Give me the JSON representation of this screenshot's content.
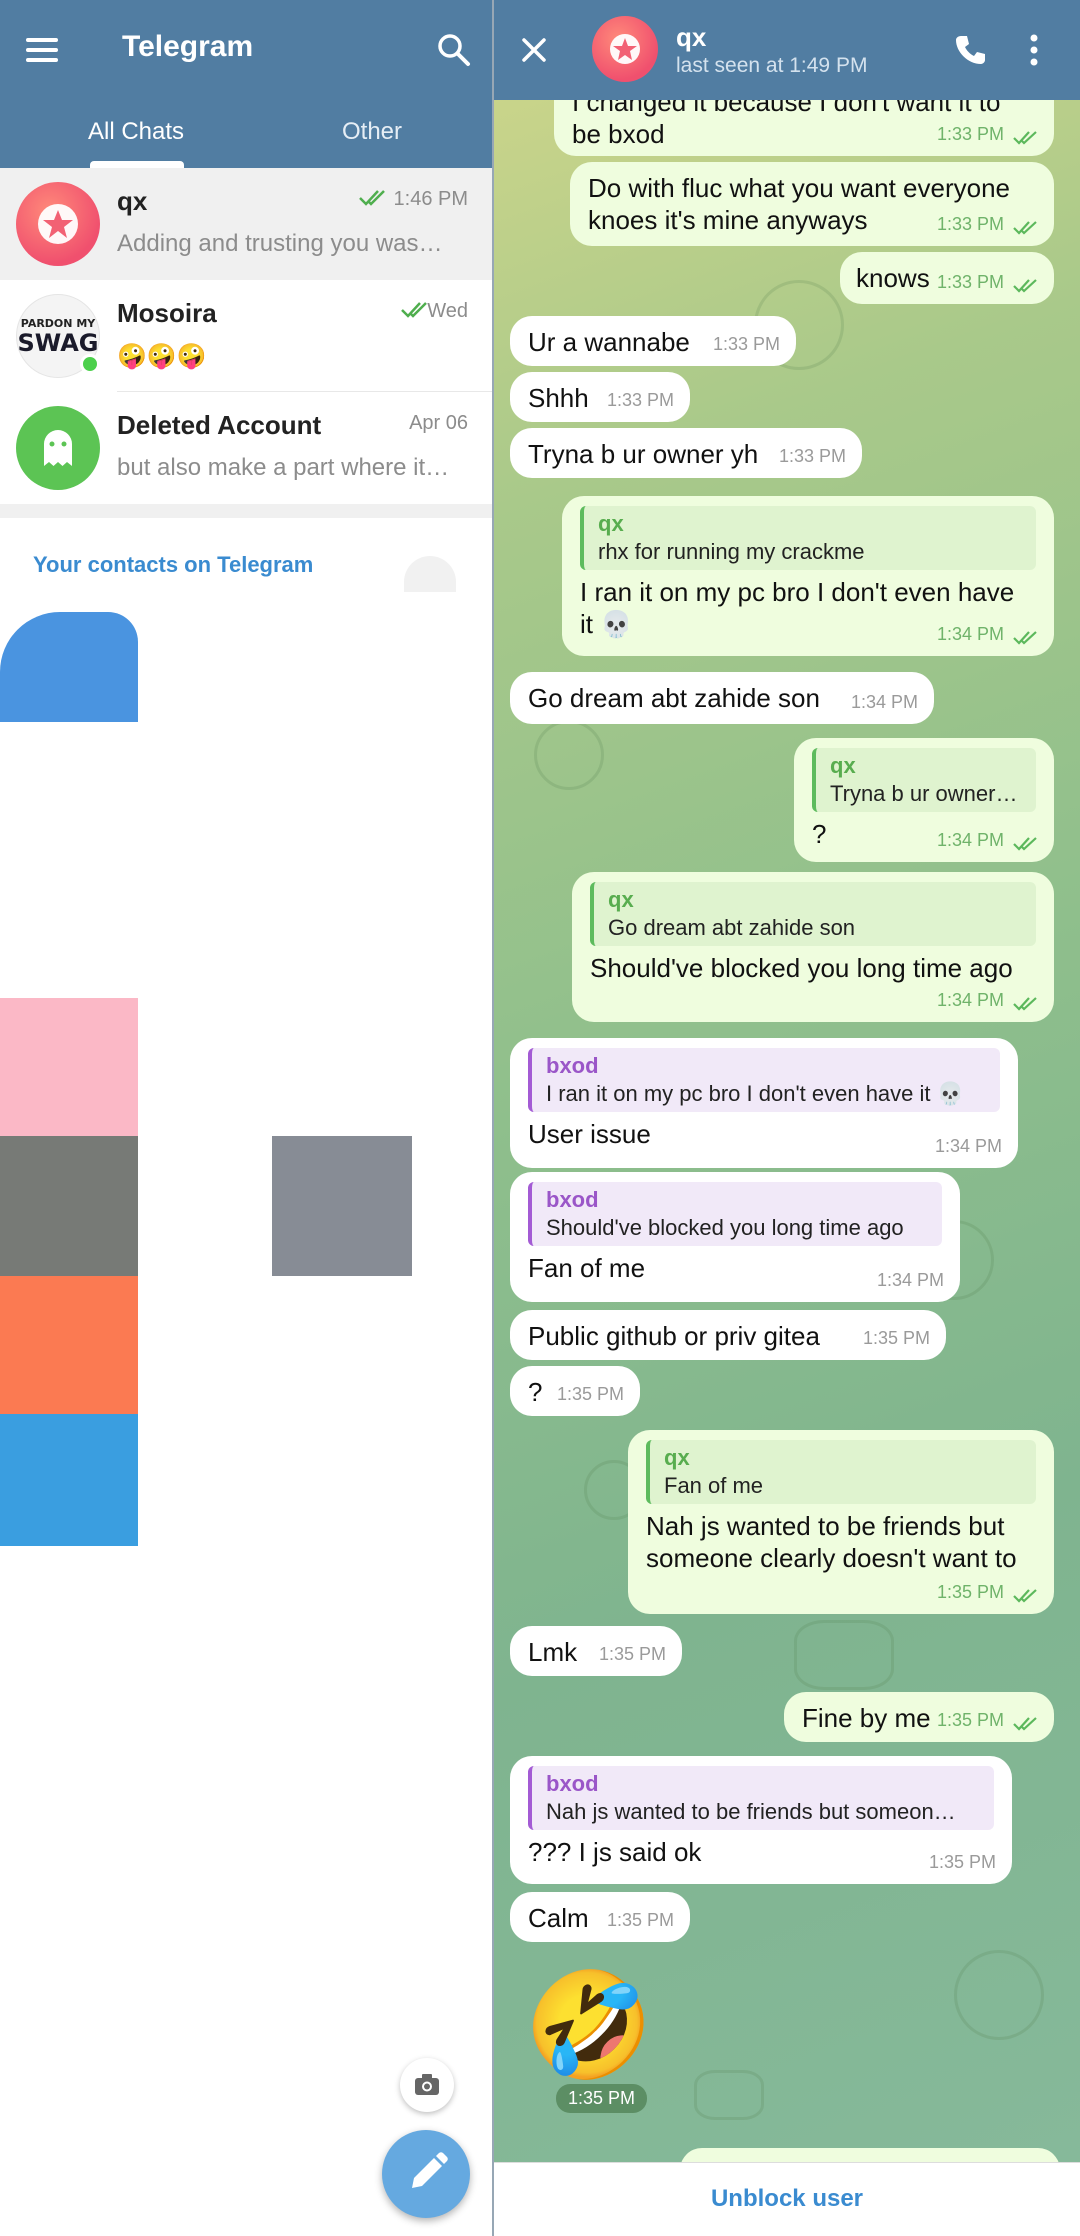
{
  "left": {
    "app_title": "Telegram",
    "tabs": [
      {
        "label": "All Chats"
      },
      {
        "label": "Other"
      }
    ],
    "chats": [
      {
        "name": "qx",
        "time": "1:46 PM",
        "preview": "Adding and trusting you was…"
      },
      {
        "name": "Mosoira",
        "time": "Wed",
        "preview": "🤪🤪🤪"
      },
      {
        "name": "Deleted Account",
        "time": "Apr 06",
        "preview": "but also make a part where it…"
      }
    ],
    "avatar_text": {
      "line1": "PARDON MY",
      "line2": "SWAG"
    },
    "contacts_title": "Your contacts on Telegram"
  },
  "right": {
    "name": "qx",
    "status": "last seen at 1:49 PM",
    "unblock": "Unblock user"
  },
  "messages": [
    {
      "text": "I changed it because I don't want it to be bxod",
      "time": "1:33 PM"
    },
    {
      "text": "Do with fluc what you want everyone knoes it's mine anyways",
      "time": "1:33 PM"
    },
    {
      "text": "knows",
      "time": "1:33 PM"
    },
    {
      "text": "Ur a wannabe",
      "time": "1:33 PM"
    },
    {
      "text": "Shhh",
      "time": "1:33 PM"
    },
    {
      "text": "Tryna b ur owner yh",
      "time": "1:33 PM"
    },
    {
      "reply_name": "qx",
      "reply_text": "rhx for running my crackme",
      "text": "I ran it on my pc bro I don't even have it 💀",
      "time": "1:34 PM"
    },
    {
      "text": "Go dream abt zahide son",
      "time": "1:34 PM"
    },
    {
      "reply_name": "qx",
      "reply_text": "Tryna b ur owner yh",
      "text": "?",
      "time": "1:34 PM"
    },
    {
      "reply_name": "qx",
      "reply_text": "Go dream abt zahide son",
      "text": "Should've blocked you long time ago",
      "time": "1:34 PM"
    },
    {
      "reply_name": "bxod",
      "reply_text": "I ran it on my pc bro I don't even have it 💀",
      "text": "User issue",
      "time": "1:34 PM"
    },
    {
      "reply_name": "bxod",
      "reply_text": "Should've blocked you long time ago",
      "text": "Fan of me",
      "time": "1:34 PM"
    },
    {
      "text": "Public github or priv gitea",
      "time": "1:35 PM"
    },
    {
      "text": "?",
      "time": "1:35 PM"
    },
    {
      "reply_name": "qx",
      "reply_text": "Fan of me",
      "text": "Nah js wanted to be friends but someone clearly doesn't want to",
      "time": "1:35 PM"
    },
    {
      "text": "Lmk",
      "time": "1:35 PM"
    },
    {
      "text": "Fine by me",
      "time": "1:35 PM"
    },
    {
      "reply_name": "bxod",
      "reply_text": "Nah js wanted to be friends but someon…",
      "text": "??? I js said ok",
      "time": "1:35 PM"
    },
    {
      "text": "Calm",
      "time": "1:35 PM"
    },
    {
      "sticker": "🤣",
      "time": "1:35 PM"
    }
  ]
}
